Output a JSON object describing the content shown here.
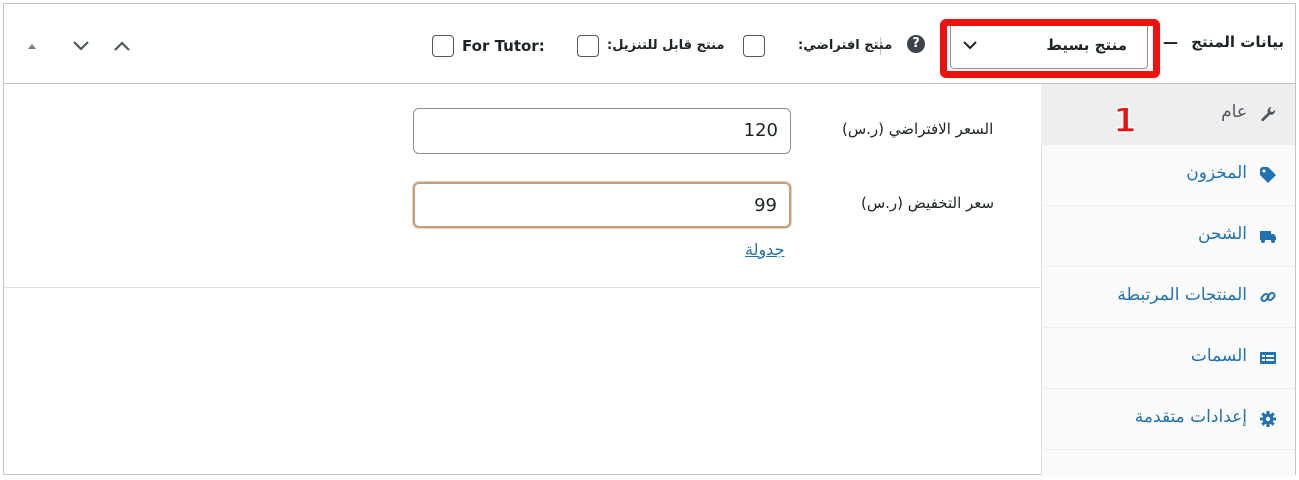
{
  "header": {
    "title": "بيانات المنتج",
    "dash": "—",
    "product_type": "منتج بسيط",
    "help_icon": "question-circle-icon",
    "checkboxes": {
      "virtual_label": "منتج افتراضي:",
      "downloadable_label": "منتج قابل للتنزيل:",
      "tutor_label": "For Tutor:"
    },
    "annotation_color": "#ee1111"
  },
  "tabs": [
    {
      "label": "عام",
      "icon": "wrench-icon"
    },
    {
      "label": "المخزون",
      "icon": "tag-icon"
    },
    {
      "label": "الشحن",
      "icon": "truck-icon"
    },
    {
      "label": "المنتجات المرتبطة",
      "icon": "link-icon"
    },
    {
      "label": "السمات",
      "icon": "list-icon"
    },
    {
      "label": "إعدادات متقدمة",
      "icon": "gear-icon"
    }
  ],
  "annotation": {
    "step_number": "1"
  },
  "fields": {
    "regular_price_label": "السعر الافتراضي (ر.س)",
    "regular_price_value": "120",
    "sale_price_label": "سعر التخفيض (ر.س)",
    "sale_price_value": "99",
    "schedule_link": "جدولة"
  },
  "colors": {
    "link": "#2271b1",
    "border": "#c3c4c7",
    "highlight": "#ee1111"
  }
}
